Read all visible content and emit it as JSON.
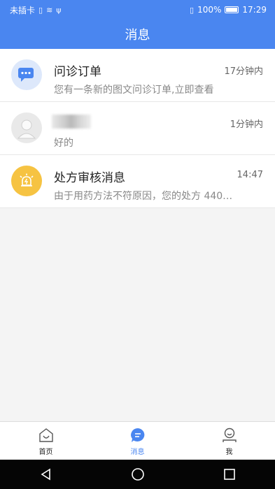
{
  "status_bar": {
    "carrier": "未插卡",
    "battery_percent": "100%",
    "time": "17:29"
  },
  "header": {
    "title": "消息"
  },
  "messages": [
    {
      "title": "问诊订单",
      "time": "17分钟内",
      "subtitle": "您有一条新的图文问诊订单,立即查看",
      "icon": "chat-icon",
      "icon_color": "#4a86f0"
    },
    {
      "title": "",
      "time": "1分钟内",
      "subtitle": "好的",
      "icon": "user-avatar-icon"
    },
    {
      "title": "处方审核消息",
      "time": "14:47",
      "subtitle": "由于用药方法不符原因，您的处方 440…",
      "icon": "alarm-icon",
      "icon_color": "#f6c342"
    }
  ],
  "tabbar": {
    "tabs": [
      {
        "label": "首页",
        "icon": "home-icon"
      },
      {
        "label": "消息",
        "icon": "message-icon",
        "active": true
      },
      {
        "label": "我",
        "icon": "profile-icon"
      }
    ]
  },
  "colors": {
    "accent": "#4a86f0",
    "alert": "#f6c342"
  }
}
